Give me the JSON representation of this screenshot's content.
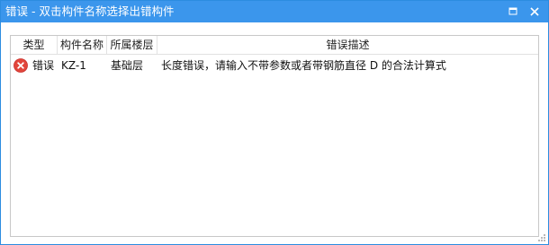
{
  "window": {
    "title": "错误 - 双击构件名称选择出错构件",
    "accent_color": "#3b96ec",
    "maximize_icon": "maximize-icon",
    "close_icon": "close-icon"
  },
  "table": {
    "columns": [
      "类型",
      "构件名称",
      "所属楼层",
      "错误描述"
    ],
    "rows": [
      {
        "icon": "error-icon",
        "icon_color": "#e2463b",
        "type": "错误",
        "name": "KZ-1",
        "floor": "基础层",
        "description": "长度错误，请输入不带参数或者带钢筋直径 D 的合法计算式"
      }
    ]
  }
}
